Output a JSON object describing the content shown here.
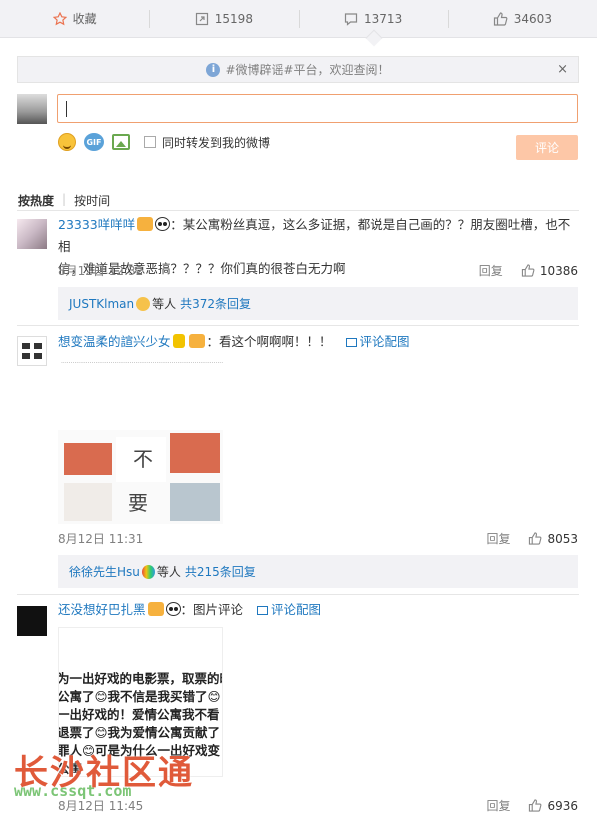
{
  "actions": {
    "favorite_label": "收藏",
    "repost_count": "15198",
    "comment_count": "13713",
    "like_count": "34603"
  },
  "notice": {
    "text": "#微博辟谣#平台，欢迎查阅！",
    "close": "×"
  },
  "compose": {
    "input_value": "",
    "gif_icon": "GIF",
    "repost_label": "同时转发到我的微博",
    "submit_label": "评论"
  },
  "sort": {
    "by_hot": "按热度",
    "by_time": "按时间"
  },
  "comments": [
    {
      "user": "23333咩咩咩",
      "text_line1": "：某公寓粉丝真逗，这么多证据，都说是自己画的？？朋友圈吐槽，也不相",
      "text_line2": "信，难道是故意恶搞？？？？你们真的很苍白无力啊",
      "time": "8月12日 12:32",
      "reply_label": "回复",
      "likes": "10386",
      "sub_user": "JUSTKlman",
      "sub_mid": "等人",
      "sub_more": "共372条回复"
    },
    {
      "user": "想变温柔的諠兴少女",
      "text": "：看这个啊啊啊！！！",
      "pic_link": "评论配图",
      "time": "8月12日 11:31",
      "reply_label": "回复",
      "likes": "8053",
      "sub_user": "徐徐先生Hsu",
      "sub_mid": "等人",
      "sub_more": "共215条回复",
      "image_chars": [
        "不",
        "要"
      ]
    },
    {
      "user": "还没想好巴扎黑",
      "text": "：图片评论",
      "pic_link": "评论配图",
      "time": "8月12日 11:45",
      "reply_label": "回复",
      "likes": "6936",
      "image_lines": [
        "为一出好戏的电影票，取票的时",
        "公寓了😊我不信是我买错了😊",
        "一出好戏的！爱情公寓我不看",
        "退票了😊我为爱情公寓贡献了",
        "罪人😊可是为什么一出好戏变",
        "公寓"
      ]
    }
  ],
  "watermark": {
    "title": "长沙社区通",
    "url": "www.cssqt.com"
  },
  "colors": {
    "accent": "#eb7350",
    "link": "#1f78bf",
    "bar_bg": "#f2f2f5",
    "submit_disabled": "#fdc7a7"
  }
}
